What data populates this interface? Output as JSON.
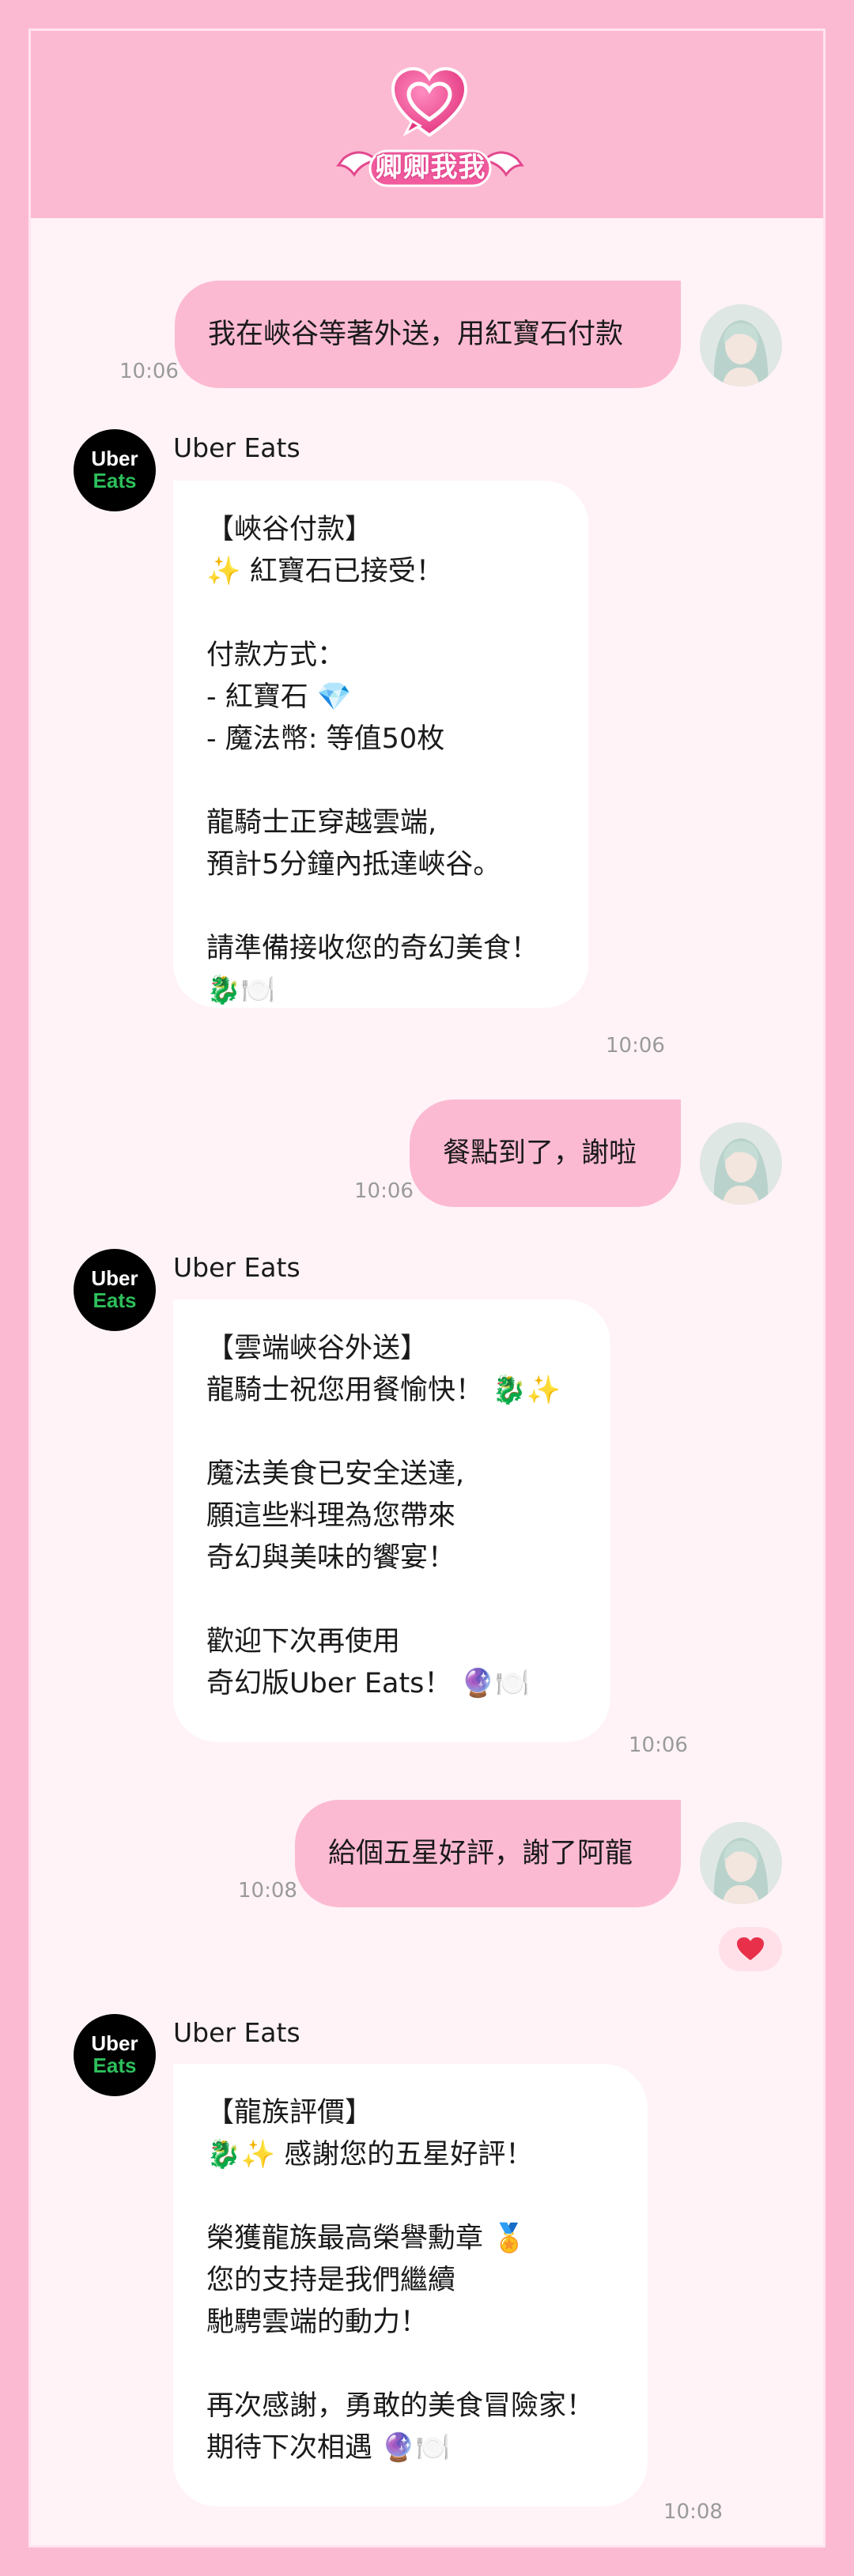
{
  "app": {
    "logo_text": "卿卿我我"
  },
  "messages": [
    {
      "id": 1,
      "dir": "out",
      "text": "我在峽谷等著外送，用紅寶石付款",
      "time": "10:06"
    },
    {
      "id": 2,
      "dir": "in",
      "sender": "Uber Eats",
      "text": "【峽谷付款】\n✨ 紅寶石已接受！\n\n付款方式：\n- 紅寶石 💎\n- 魔法幣: 等值50枚\n\n龍騎士正穿越雲端,\n預計5分鐘內抵達峽谷。\n\n請準備接收您的奇幻美食！\n🐉🍽️",
      "time": "10:06"
    },
    {
      "id": 3,
      "dir": "out",
      "text": "餐點到了，謝啦",
      "time": "10:06"
    },
    {
      "id": 4,
      "dir": "in",
      "sender": "Uber Eats",
      "text": "【雲端峽谷外送】\n龍騎士祝您用餐愉快！ 🐉✨\n\n魔法美食已安全送達,\n願這些料理為您帶來\n奇幻與美味的饗宴！\n\n歡迎下次再使用\n奇幻版Uber Eats！ 🔮🍽️",
      "time": "10:06"
    },
    {
      "id": 5,
      "dir": "out",
      "text": "給個五星好評，謝了阿龍",
      "time": "10:08",
      "reaction": "heart-icon"
    },
    {
      "id": 6,
      "dir": "in",
      "sender": "Uber Eats",
      "text": "【龍族評價】\n🐉✨ 感謝您的五星好評！\n\n榮獲龍族最高榮譽勳章 🏅\n您的支持是我們繼續\n馳騁雲端的動力！\n\n再次感謝，勇敢的美食冒險家！\n期待下次相遇 🔮🍽️",
      "time": "10:08"
    }
  ],
  "bot_avatar": {
    "line1": "Uber",
    "line2": "Eats"
  },
  "colors": {
    "background": "#FCBAD2",
    "chat_bg": "#FFF3F7",
    "outgoing_bubble": "#FCBAD2",
    "incoming_bubble": "#FFFFFF",
    "brand_green": "#2DBF5B",
    "heart": "#E8304A"
  }
}
